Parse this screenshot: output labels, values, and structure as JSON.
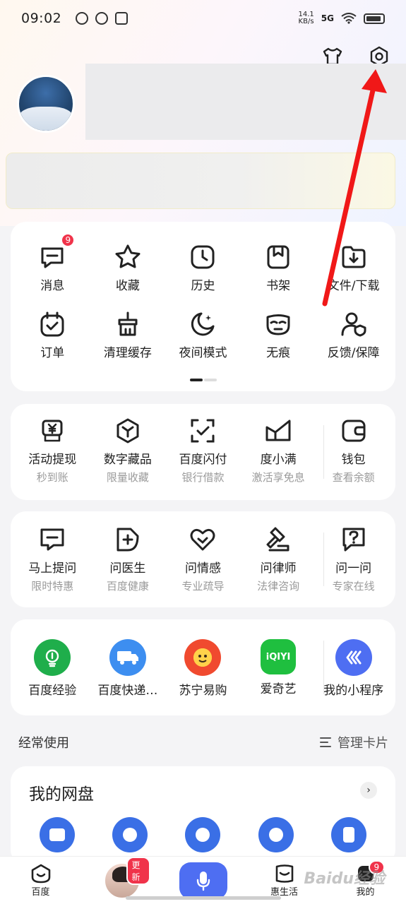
{
  "status_bar": {
    "time": "09:02",
    "net_speed_value": "14.1",
    "net_speed_unit": "KB/s",
    "network": "5G"
  },
  "menu_grid": {
    "items": [
      {
        "label": "消息",
        "icon": "message-icon",
        "badge": "9"
      },
      {
        "label": "收藏",
        "icon": "star-icon"
      },
      {
        "label": "历史",
        "icon": "clock-icon"
      },
      {
        "label": "书架",
        "icon": "bookshelf-icon"
      },
      {
        "label": "文件/下载",
        "icon": "download-icon"
      },
      {
        "label": "订单",
        "icon": "calendar-icon"
      },
      {
        "label": "清理缓存",
        "icon": "broom-icon"
      },
      {
        "label": "夜间模式",
        "icon": "moon-icon"
      },
      {
        "label": "无痕",
        "icon": "mask-icon"
      },
      {
        "label": "反馈/保障",
        "icon": "user-shield-icon"
      }
    ]
  },
  "finance": {
    "items": [
      {
        "label": "活动提现",
        "sub": "秒到账",
        "icon": "cash-icon"
      },
      {
        "label": "数字藏品",
        "sub": "限量收藏",
        "icon": "cube-icon"
      },
      {
        "label": "百度闪付",
        "sub": "银行借款",
        "icon": "scan-check-icon"
      },
      {
        "label": "度小满",
        "sub": "激活享免息",
        "icon": "duxiaoman-icon"
      },
      {
        "label": "钱包",
        "sub": "查看余额",
        "icon": "wallet-icon"
      }
    ]
  },
  "consult": {
    "items": [
      {
        "label": "马上提问",
        "sub": "限时特惠",
        "icon": "question-bubble-icon"
      },
      {
        "label": "问医生",
        "sub": "百度健康",
        "icon": "medical-icon"
      },
      {
        "label": "问情感",
        "sub": "专业疏导",
        "icon": "heart-icon"
      },
      {
        "label": "问律师",
        "sub": "法律咨询",
        "icon": "gavel-icon"
      },
      {
        "label": "问一问",
        "sub": "专家在线",
        "icon": "help-icon"
      }
    ]
  },
  "apps": {
    "items": [
      {
        "label": "百度经验",
        "icon": "baidu-jingyan-icon",
        "color": "#1fae4b"
      },
      {
        "label": "百度快递…",
        "icon": "baidu-express-icon",
        "color": "#3d8ef0"
      },
      {
        "label": "苏宁易购",
        "icon": "suning-icon",
        "color": "#f04a2f"
      },
      {
        "label": "爱奇艺",
        "icon": "iqiyi-icon",
        "color": "#1fbf3f",
        "logo_text": "iQIYI"
      },
      {
        "label": "我的小程序",
        "icon": "mini-program-icon",
        "color": "#4e6ef2"
      }
    ]
  },
  "frequent": {
    "title": "经常使用",
    "manage": "管理卡片"
  },
  "netdisk": {
    "title": "我的网盘"
  },
  "bottom_nav": {
    "home": "百度",
    "update_badge": "更新",
    "life": "惠生活",
    "me": "我的",
    "me_badge": "9"
  },
  "watermark": "Baidu经验",
  "colors": {
    "accent_blue": "#4e6ef2",
    "badge_red": "#f0334a",
    "annotation_arrow": "#f01818"
  }
}
